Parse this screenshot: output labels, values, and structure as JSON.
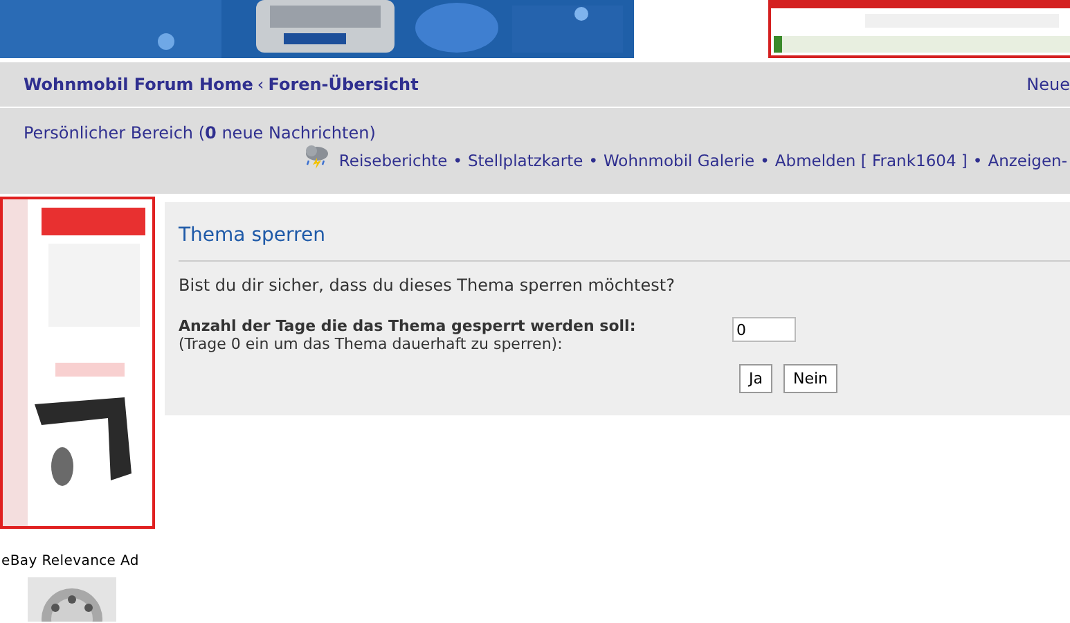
{
  "nav": {
    "breadcrumbs": [
      {
        "label": "Wohnmobil Forum Home"
      },
      {
        "label": "Foren-Übersicht"
      }
    ],
    "separator": "‹",
    "right_link": "Neue"
  },
  "user_bar": {
    "personal": {
      "label": "Persönlicher Bereich (",
      "count": "0",
      "suffix": " neue Nachrichten)"
    },
    "links": [
      "Reiseberichte",
      "Stellplatzkarte",
      "Wohnmobil Galerie",
      "Abmelden [ Frank1604 ]",
      "Anzeigen-"
    ],
    "separator": "•"
  },
  "sidebar": {
    "ad_label": "eBay Relevance Ad"
  },
  "dialog": {
    "title": "Thema sperren",
    "question": "Bist du dir sicher, dass du dieses Thema sperren möchtest?",
    "field_label": "Anzahl der Tage die das Thema gesperrt werden soll:",
    "field_hint": "(Trage 0 ein um das Thema dauerhaft zu sperren):",
    "field_value": "0",
    "buttons": [
      "Ja",
      "Nein"
    ]
  }
}
